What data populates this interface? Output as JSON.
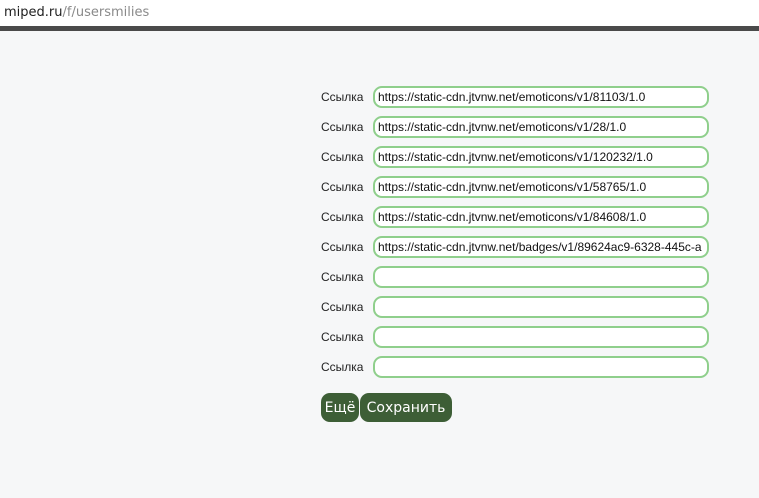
{
  "browser": {
    "url_host": "miped.ru",
    "url_path": "/f/usersmilies"
  },
  "form": {
    "link_label": "Ссылка",
    "rows": [
      {
        "label": "Ссылка",
        "value": "https://static-cdn.jtvnw.net/emoticons/v1/81103/1.0"
      },
      {
        "label": "Ссылка",
        "value": "https://static-cdn.jtvnw.net/emoticons/v1/28/1.0"
      },
      {
        "label": "Ссылка",
        "value": "https://static-cdn.jtvnw.net/emoticons/v1/120232/1.0"
      },
      {
        "label": "Ссылка",
        "value": "https://static-cdn.jtvnw.net/emoticons/v1/58765/1.0"
      },
      {
        "label": "Ссылка",
        "value": "https://static-cdn.jtvnw.net/emoticons/v1/84608/1.0"
      },
      {
        "label": "Ссылка",
        "value": "https://static-cdn.jtvnw.net/badges/v1/89624ac9-6328-445c-a"
      },
      {
        "label": "Ссылка",
        "value": ""
      },
      {
        "label": "Ссылка",
        "value": ""
      },
      {
        "label": "Ссылка",
        "value": ""
      },
      {
        "label": "Ссылка",
        "value": ""
      }
    ]
  },
  "actions": {
    "more_label": "Ещё",
    "save_label": "Сохранить"
  },
  "colors": {
    "input_border": "#8fcf8c",
    "button_bg": "#3d5e36",
    "page_bg": "#f6f7f8",
    "divider": "#4a4a4a"
  }
}
